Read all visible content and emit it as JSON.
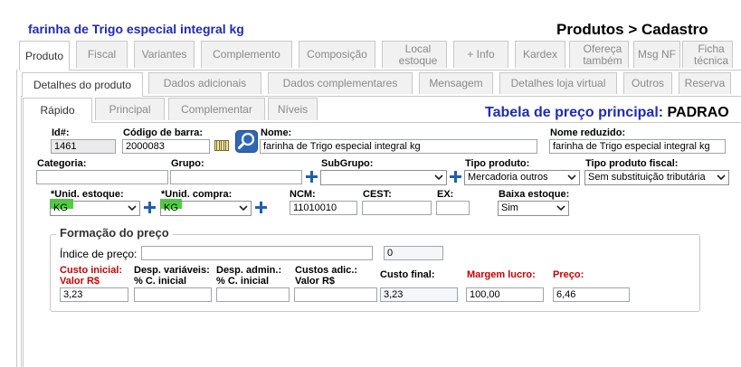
{
  "header": {
    "product_name": "farinha de Trigo especial integral kg",
    "page_title": "Produtos > Cadastro"
  },
  "main_tabs": [
    {
      "label": "Produto"
    },
    {
      "label": "Fiscal"
    },
    {
      "label": "Variantes"
    },
    {
      "label": "Complemento"
    },
    {
      "label": "Composição"
    },
    {
      "label": "Local estoque"
    },
    {
      "label": "+ Info"
    },
    {
      "label": "Kardex"
    },
    {
      "label": "Ofereça também"
    },
    {
      "label": "Msg NF"
    },
    {
      "label": "Ficha técnica"
    }
  ],
  "sub_tabs": [
    {
      "label": "Detalhes do produto"
    },
    {
      "label": "Dados adicionais"
    },
    {
      "label": "Dados complementares"
    },
    {
      "label": "Mensagem"
    },
    {
      "label": "Detalhes loja virtual"
    },
    {
      "label": "Outros"
    },
    {
      "label": "Reserva"
    }
  ],
  "inner_tabs": [
    {
      "label": "Rápido"
    },
    {
      "label": "Principal"
    },
    {
      "label": "Complementar"
    },
    {
      "label": "Níveis"
    }
  ],
  "price_table": {
    "label": "Tabela de preço principal:",
    "value": "PADRAO"
  },
  "form": {
    "id_label": "Id#:",
    "id_value": "1461",
    "barcode_label": "Código de barra:",
    "barcode_value": "2000083",
    "name_label": "Nome:",
    "name_value": "farinha de Trigo especial integral  kg",
    "short_name_label": "Nome reduzido:",
    "short_name_value": "farinha de Trigo especial integral  kg",
    "category_label": "Categoria:",
    "category_value": "",
    "group_label": "Grupo:",
    "group_value": "",
    "subgroup_label": "SubGrupo:",
    "subgroup_value": "",
    "product_type_label": "Tipo produto:",
    "product_type_value": "Mercadoria outros",
    "fiscal_type_label": "Tipo produto fiscal:",
    "fiscal_type_value": "Sem substituição tributária",
    "stock_unit_label": "*Unid. estoque:",
    "stock_unit_value": "KG",
    "purchase_unit_label": "*Unid. compra:",
    "purchase_unit_value": "KG",
    "ncm_label": "NCM:",
    "ncm_value": "11010010",
    "cest_label": "CEST:",
    "cest_value": "",
    "ex_label": "EX:",
    "ex_value": "",
    "low_stock_label": "Baixa estoque:",
    "low_stock_value": "Sim"
  },
  "pricing": {
    "section_title": "Formação do preço",
    "price_index_label": "Índice de preço:",
    "price_index_value": "",
    "price_index_number": "0",
    "initial_cost_label_1": "Custo inicial:",
    "initial_cost_label_2": "Valor R$",
    "initial_cost_value": "3,23",
    "var_exp_label_1": "Desp. variáveis:",
    "var_exp_label_2": "% C. inicial",
    "var_exp_value": "",
    "admin_exp_label_1": "Desp. admin.:",
    "admin_exp_label_2": "% C. inicial",
    "admin_exp_value": "",
    "add_cost_label_1": "Custos adic.:",
    "add_cost_label_2": "Valor R$",
    "add_cost_value": "",
    "final_cost_label": "Custo final:",
    "final_cost_value": "3,23",
    "margin_label": "Margem lucro:",
    "margin_value": "100,00",
    "price_label": "Preço:",
    "price_value": "6,46"
  },
  "colors": {
    "title_blue": "#1f2bb5",
    "required_red": "#cc0000",
    "plus_blue": "#1e5fb0",
    "highlight_green": "#46d436"
  },
  "icons": {
    "search": "magnifier-icon",
    "barcode": "barcode-icon",
    "add": "plus-icon",
    "dropdown": "chevron-down-icon"
  }
}
